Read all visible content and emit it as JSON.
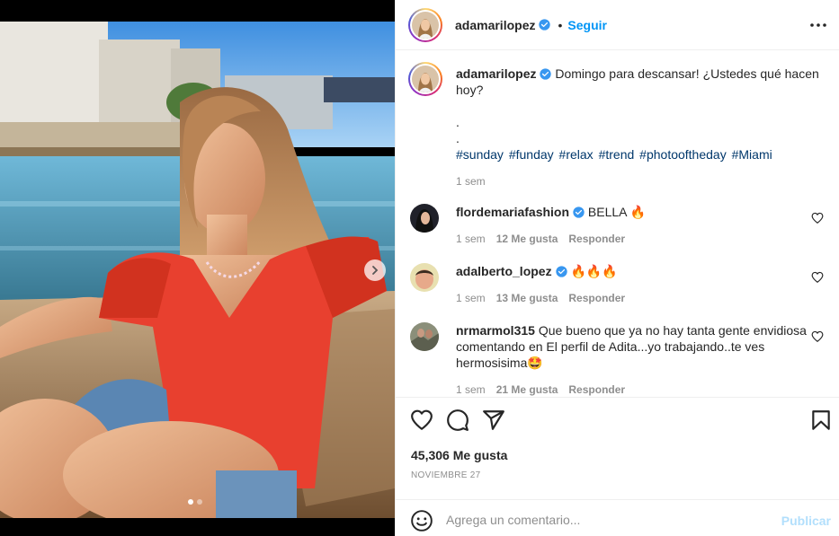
{
  "post": {
    "author": "adamarilopez",
    "follow_label": "Seguir",
    "separator": "•",
    "caption_text": "Domingo para descansar! ¿Ustedes qué hacen hoy?",
    "caption_dot1": ".",
    "caption_dot2": ".",
    "hashtags": [
      "#sunday",
      "#funday",
      "#relax",
      "#trend",
      "#photooftheday",
      "#Miami"
    ],
    "caption_age": "1 sem"
  },
  "comments": [
    {
      "user": "flordemariafashion",
      "text": "BELLA 🔥",
      "age": "1 sem",
      "likes": "12 Me gusta",
      "reply": "Responder"
    },
    {
      "user": "adalberto_lopez",
      "text": "🔥🔥🔥",
      "age": "1 sem",
      "likes": "13 Me gusta",
      "reply": "Responder"
    },
    {
      "user": "nrmarmol315",
      "text": "Que bueno que ya no hay tanta gente envidiosa comentando en El perfil de Adita...yo trabajando..te ves hermosisima🤩",
      "age": "1 sem",
      "likes": "21 Me gusta",
      "reply": "Responder"
    }
  ],
  "stats": {
    "likes": "45,306 Me gusta",
    "date": "NOVIEMBRE 27"
  },
  "composer": {
    "placeholder": "Agrega un comentario...",
    "publish_label": "Publicar"
  },
  "colors": {
    "accent": "#0095f6",
    "verified": "#3897f0",
    "muted": "#8e8e8e",
    "hashtag": "#00376b",
    "publish_disabled": "#b2dffc"
  },
  "carousel": {
    "current": 1,
    "total": 2
  }
}
